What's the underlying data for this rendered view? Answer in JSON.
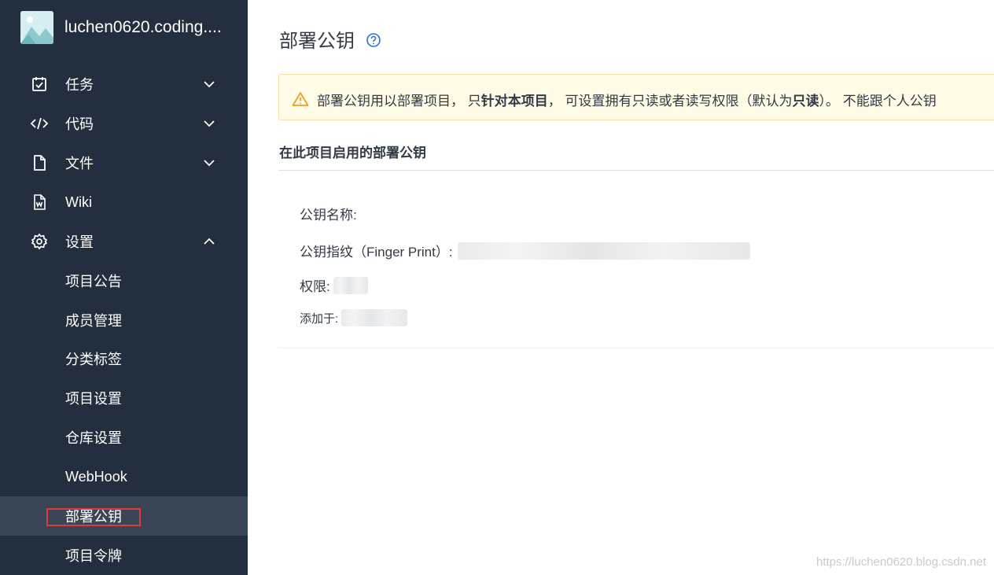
{
  "sidebar": {
    "project_name": "luchen0620.coding....",
    "items": [
      {
        "label": "任务",
        "icon": "task-check-icon",
        "chevron": "down"
      },
      {
        "label": "代码",
        "icon": "code-icon",
        "chevron": "down"
      },
      {
        "label": "文件",
        "icon": "file-icon",
        "chevron": "down"
      },
      {
        "label": "Wiki",
        "icon": "wiki-doc-icon",
        "chevron": ""
      },
      {
        "label": "设置",
        "icon": "gear-icon",
        "chevron": "up"
      }
    ],
    "sub_items": [
      {
        "label": "项目公告"
      },
      {
        "label": "成员管理"
      },
      {
        "label": "分类标签"
      },
      {
        "label": "项目设置"
      },
      {
        "label": "仓库设置"
      },
      {
        "label": "WebHook"
      },
      {
        "label": "部署公钥",
        "active": true
      },
      {
        "label": "项目令牌"
      }
    ]
  },
  "main": {
    "title": "部署公钥",
    "alert": {
      "part1": "部署公钥用以部署项目， 只",
      "bold1": "针对本项目",
      "part2": "， 可设置拥有只读或者读写权限（默认为",
      "bold2": "只读",
      "part3": "）。 不能跟个人公钥"
    },
    "section_title": "在此项目启用的部署公钥",
    "fields": {
      "name_label": "公钥名称:",
      "fingerprint_label": "公钥指纹（Finger Print）:",
      "permission_label": "权限:",
      "added_label": "添加于:"
    }
  },
  "watermark": "https://luchen0620.blog.csdn.net",
  "colors": {
    "sidebar_bg": "#232f3f",
    "active_bg": "#3a4656",
    "highlight_border": "#e23a3a",
    "alert_bg": "#fffbe6",
    "warning": "#f0a020",
    "help_blue": "#2b72d6"
  }
}
